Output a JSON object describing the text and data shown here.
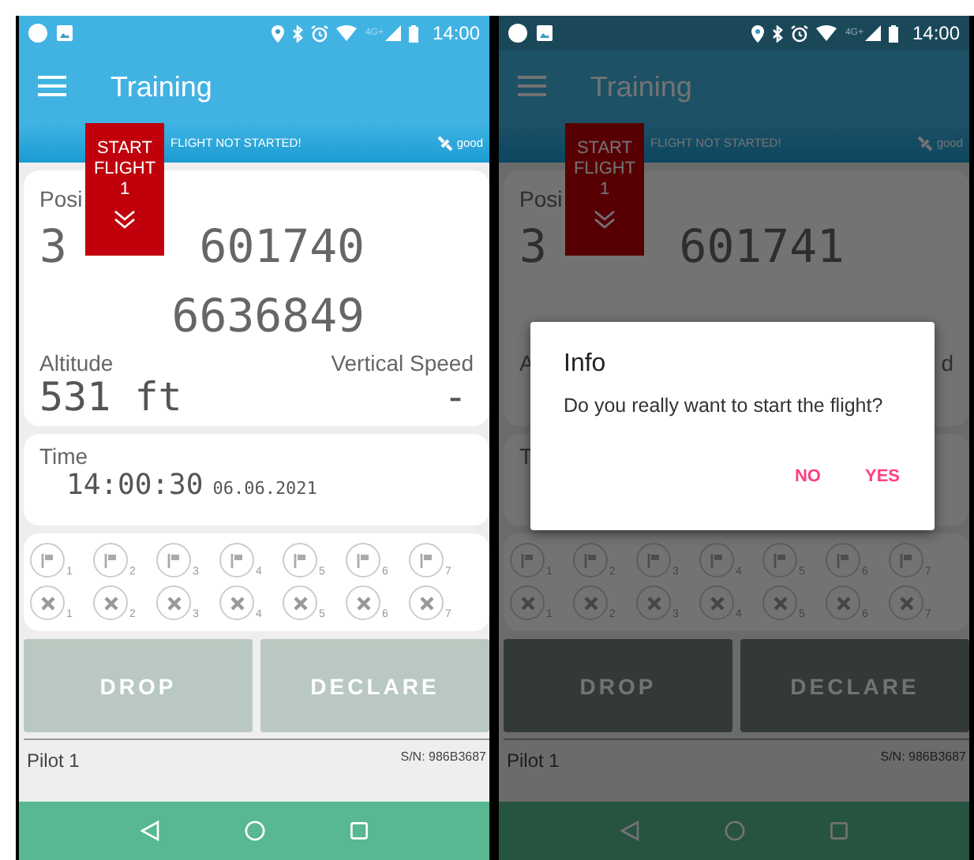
{
  "screens": [
    {
      "status_bar": {
        "time": "14:00",
        "network": "4G+"
      },
      "toolbar": {
        "title": "Training"
      },
      "start_flight_button": {
        "lines": [
          "START",
          "FLIGHT",
          "1"
        ]
      },
      "flight_status": "FLIGHT NOT STARTED!",
      "gps_quality": "good",
      "position": {
        "label": "Posi",
        "zone": "3",
        "easting": "601740",
        "northing": "6636849"
      },
      "altitude": {
        "label": "Altitude",
        "value": "531 ft"
      },
      "vertical_speed": {
        "label": "Vertical Speed",
        "value": "-"
      },
      "time": {
        "label": "Time",
        "value": "14:00:30",
        "date": "06.06.2021"
      },
      "markers": {
        "flags": [
          "1",
          "2",
          "3",
          "4",
          "5",
          "6",
          "7"
        ],
        "crosses": [
          "1",
          "2",
          "3",
          "4",
          "5",
          "6",
          "7"
        ]
      },
      "buttons": [
        {
          "label": "DROP",
          "disabled": true
        },
        {
          "label": "DECLARE",
          "disabled": true
        }
      ],
      "footer": {
        "pilot": "Pilot 1",
        "serial": "S/N: 986B3687"
      }
    },
    {
      "status_bar": {
        "time": "14:00",
        "network": "4G+"
      },
      "toolbar": {
        "title": "Training"
      },
      "start_flight_button": {
        "lines": [
          "START",
          "FLIGHT",
          "1"
        ]
      },
      "flight_status": "FLIGHT NOT STARTED!",
      "gps_quality": "good",
      "position": {
        "label": "Posi",
        "zone": "3",
        "easting": "601741"
      },
      "altitude": {
        "label": "A"
      },
      "vertical_speed": {
        "label": "d"
      },
      "time": {
        "label": "T"
      },
      "markers": {
        "flags": [
          "1",
          "2",
          "3",
          "4",
          "5",
          "6",
          "7"
        ],
        "crosses": [
          "1",
          "2",
          "3",
          "4",
          "5",
          "6",
          "7"
        ]
      },
      "buttons": [
        {
          "label": "DROP",
          "disabled": true
        },
        {
          "label": "DECLARE",
          "disabled": true
        }
      ],
      "footer": {
        "pilot": "Pilot 1",
        "serial": "S/N: 986B3687"
      },
      "dialog": {
        "title": "Info",
        "message": "Do you really want to start the flight?",
        "buttons": [
          "NO",
          "YES"
        ]
      }
    }
  ]
}
